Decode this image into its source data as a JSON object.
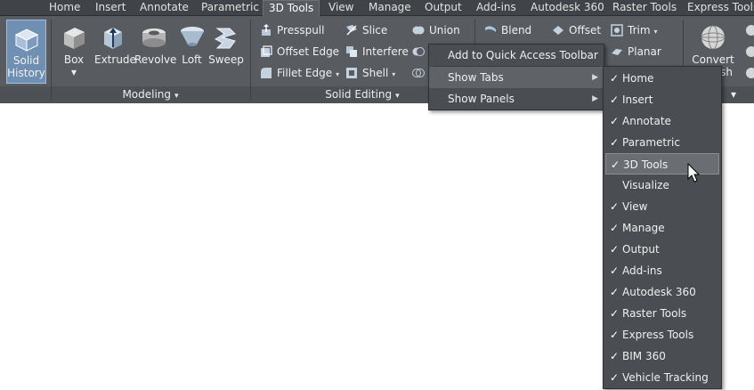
{
  "tabs": [
    {
      "label": "Home"
    },
    {
      "label": "Insert"
    },
    {
      "label": "Annotate"
    },
    {
      "label": "Parametric"
    },
    {
      "label": "3D Tools"
    },
    {
      "label": "View"
    },
    {
      "label": "Manage"
    },
    {
      "label": "Output"
    },
    {
      "label": "Add-ins"
    },
    {
      "label": "Autodesk 360"
    },
    {
      "label": "Raster Tools"
    },
    {
      "label": "Express Tools"
    }
  ],
  "active_tab": "3D Tools",
  "ribbon": {
    "solid_history": {
      "line1": "Solid",
      "line2": "History"
    },
    "modeling": {
      "title": "Modeling",
      "box": "Box",
      "extrude": "Extrude",
      "revolve": "Revolve",
      "loft": "Loft",
      "sweep": "Sweep"
    },
    "solid_editing": {
      "title": "Solid Editing",
      "presspull": "Presspull",
      "offset_edge": "Offset Edge",
      "fillet_edge": "Fillet Edge",
      "slice": "Slice",
      "interfere": "Interfere",
      "shell": "Shell",
      "union": "Union"
    },
    "surface": {
      "blend": "Blend",
      "offset": "Offset",
      "trim": "Trim",
      "planar": "Planar"
    },
    "mesh": {
      "convert": "Convert",
      "mesh_partial": "sh"
    }
  },
  "context_menu": {
    "items": [
      {
        "label": "Add to Quick Access Toolbar"
      },
      {
        "label": "Show Tabs"
      },
      {
        "label": "Show Panels"
      }
    ]
  },
  "show_tabs_menu": {
    "items": [
      {
        "label": "Home",
        "checked": true
      },
      {
        "label": "Insert",
        "checked": true
      },
      {
        "label": "Annotate",
        "checked": true
      },
      {
        "label": "Parametric",
        "checked": true
      },
      {
        "label": "3D Tools",
        "checked": true
      },
      {
        "label": "Visualize",
        "checked": false
      },
      {
        "label": "View",
        "checked": true
      },
      {
        "label": "Manage",
        "checked": true
      },
      {
        "label": "Output",
        "checked": true
      },
      {
        "label": "Add-ins",
        "checked": true
      },
      {
        "label": "Autodesk 360",
        "checked": true
      },
      {
        "label": "Raster Tools",
        "checked": true
      },
      {
        "label": "Express Tools",
        "checked": true
      },
      {
        "label": "BIM 360",
        "checked": true
      },
      {
        "label": "Vehicle Tracking",
        "checked": true
      }
    ]
  },
  "icons": {
    "check": "✓",
    "submenu_arrow": "▶",
    "dropdown_arrow": "▾"
  },
  "colors": {
    "accent": "#6f8fb3",
    "ribbon_bg": "#585b60",
    "menu_bg": "#4a4d51"
  }
}
